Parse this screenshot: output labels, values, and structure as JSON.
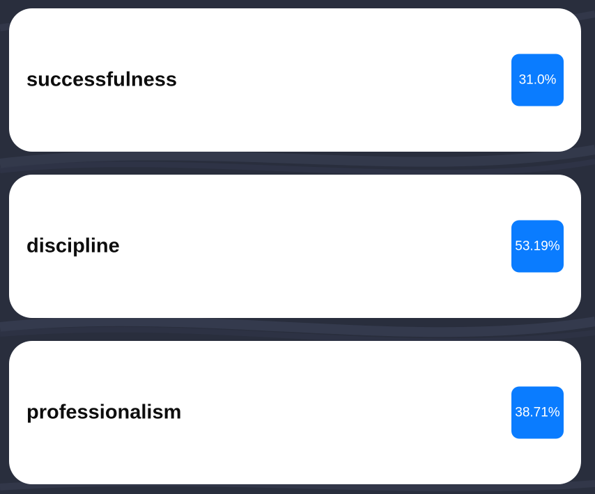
{
  "colors": {
    "background": "#2a2f3f",
    "card": "#ffffff",
    "badge": "#0a7cff",
    "label_text": "#0d0d0d",
    "badge_text": "#ffffff"
  },
  "cards": [
    {
      "label": "successfulness",
      "percent": "31.0%"
    },
    {
      "label": "discipline",
      "percent": "53.19%"
    },
    {
      "label": "professionalism",
      "percent": "38.71%"
    }
  ]
}
